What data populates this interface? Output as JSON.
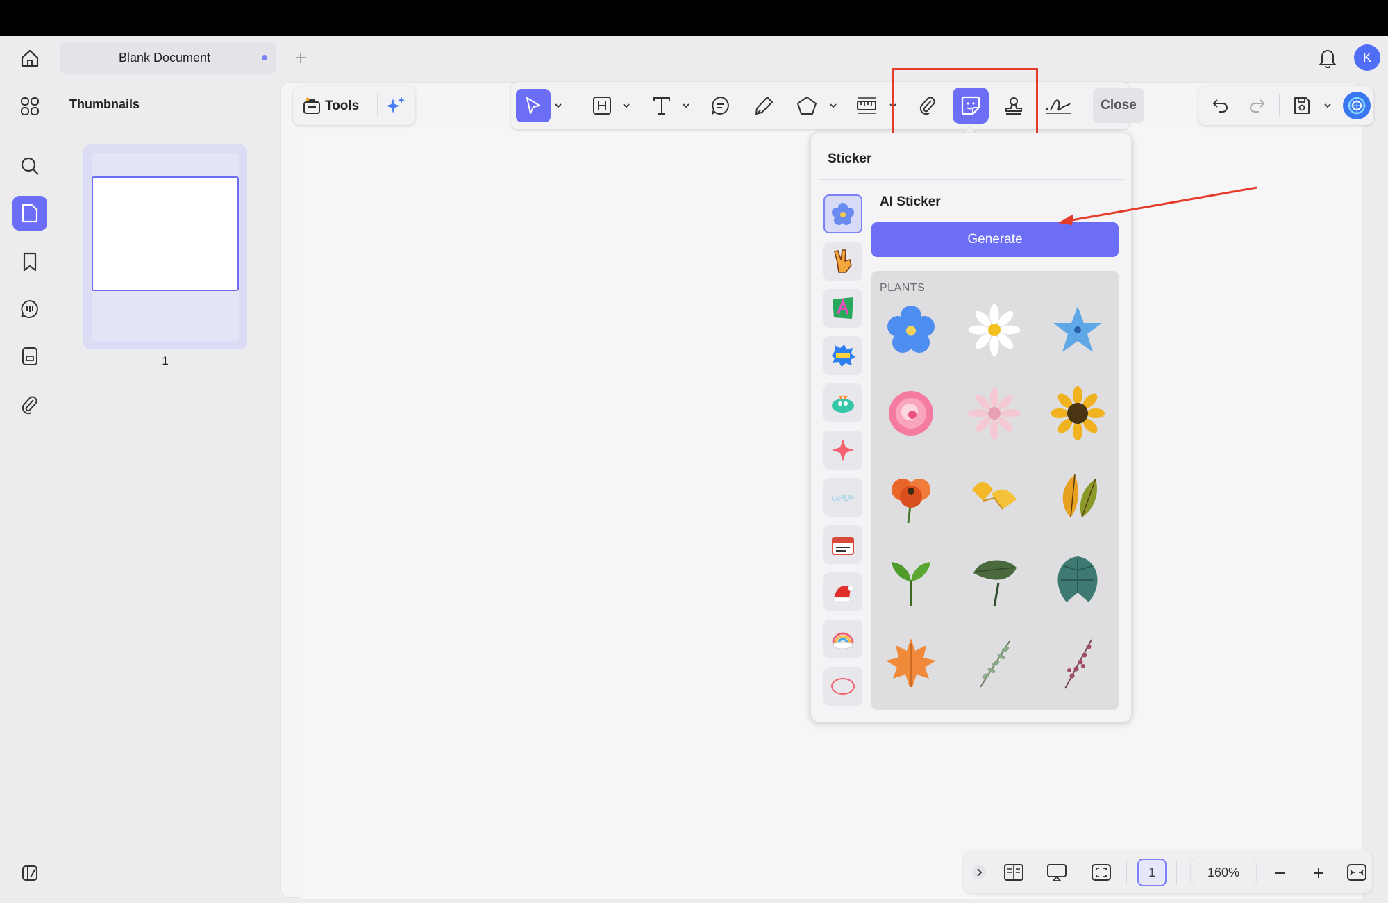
{
  "tab": {
    "title": "Blank Document"
  },
  "thumbnails": {
    "title": "Thumbnails",
    "page_number": "1"
  },
  "toolbar": {
    "tools_label": "Tools",
    "close_label": "Close"
  },
  "sticker_panel": {
    "title": "Sticker",
    "ai_title": "AI Sticker",
    "generate_label": "Generate",
    "section_label": "PLANTS",
    "stickers": [
      "blue-forget-me-not",
      "white-daisy",
      "blue-star-flower",
      "pink-rose",
      "pink-gerbera",
      "sunflower",
      "orange-poppy",
      "ginkgo-leaves",
      "autumn-leaves",
      "green-sprout",
      "monstera-leaf",
      "monstera-dark",
      "maple-leaf",
      "eucalyptus-sprig",
      "red-berry-sprig"
    ]
  },
  "bottom": {
    "page": "1",
    "zoom": "160%"
  },
  "avatar": {
    "initial": "K",
    "color": "#4f6df5"
  },
  "colors": {
    "accent": "#6c6ff6",
    "annotation": "#e53b2a"
  }
}
